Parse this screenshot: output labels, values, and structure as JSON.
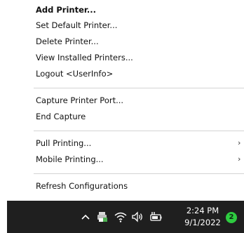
{
  "menu": {
    "items": [
      {
        "label": "Add Printer...",
        "bold": true
      },
      {
        "label": "Set Default Printer..."
      },
      {
        "label": "Delete Printer..."
      },
      {
        "label": "View Installed Printers..."
      },
      {
        "label": "Logout <UserInfo>"
      },
      {
        "label": "Capture Printer Port..."
      },
      {
        "label": "End Capture"
      },
      {
        "label": "Pull Printing...",
        "submenu": true
      },
      {
        "label": "Mobile Printing...",
        "submenu": true
      },
      {
        "label": "Refresh Configurations"
      }
    ],
    "submenu_glyph": "›"
  },
  "taskbar": {
    "time": "2:24 PM",
    "date": "9/1/2022",
    "notification_count": "2",
    "icons": [
      "chevron-up-icon",
      "printer-tray-icon",
      "wifi-icon",
      "speaker-icon",
      "battery-icon"
    ],
    "colors": {
      "background": "#1f1f1f",
      "badge": "#2ecc40",
      "tray_accent": "#4caf50"
    }
  }
}
